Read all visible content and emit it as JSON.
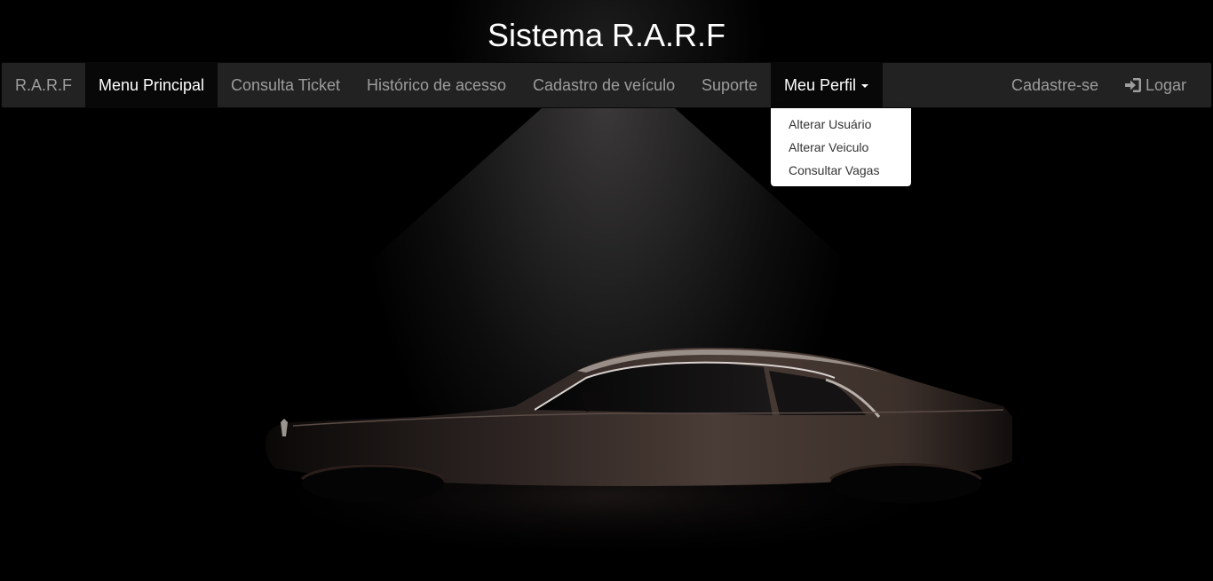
{
  "page": {
    "title": "Sistema R.A.R.F"
  },
  "navbar": {
    "brand": "R.A.R.F",
    "items": [
      {
        "label": "Menu Principal",
        "active": true
      },
      {
        "label": "Consulta Ticket"
      },
      {
        "label": "Histórico de acesso"
      },
      {
        "label": "Cadastro de veículo"
      },
      {
        "label": "Suporte"
      },
      {
        "label": "Meu Perfil",
        "open": true
      }
    ],
    "right": {
      "register": "Cadastre-se",
      "login": "Logar"
    }
  },
  "dropdown": {
    "items": [
      "Alterar Usuário",
      "Alterar Veiculo",
      "Consultar Vagas"
    ]
  },
  "colors": {
    "background": "#000000",
    "navbar": "#222222",
    "navbar_active": "#080808",
    "nav_text": "#9d9d9d",
    "car_body": "#4a3c36"
  }
}
